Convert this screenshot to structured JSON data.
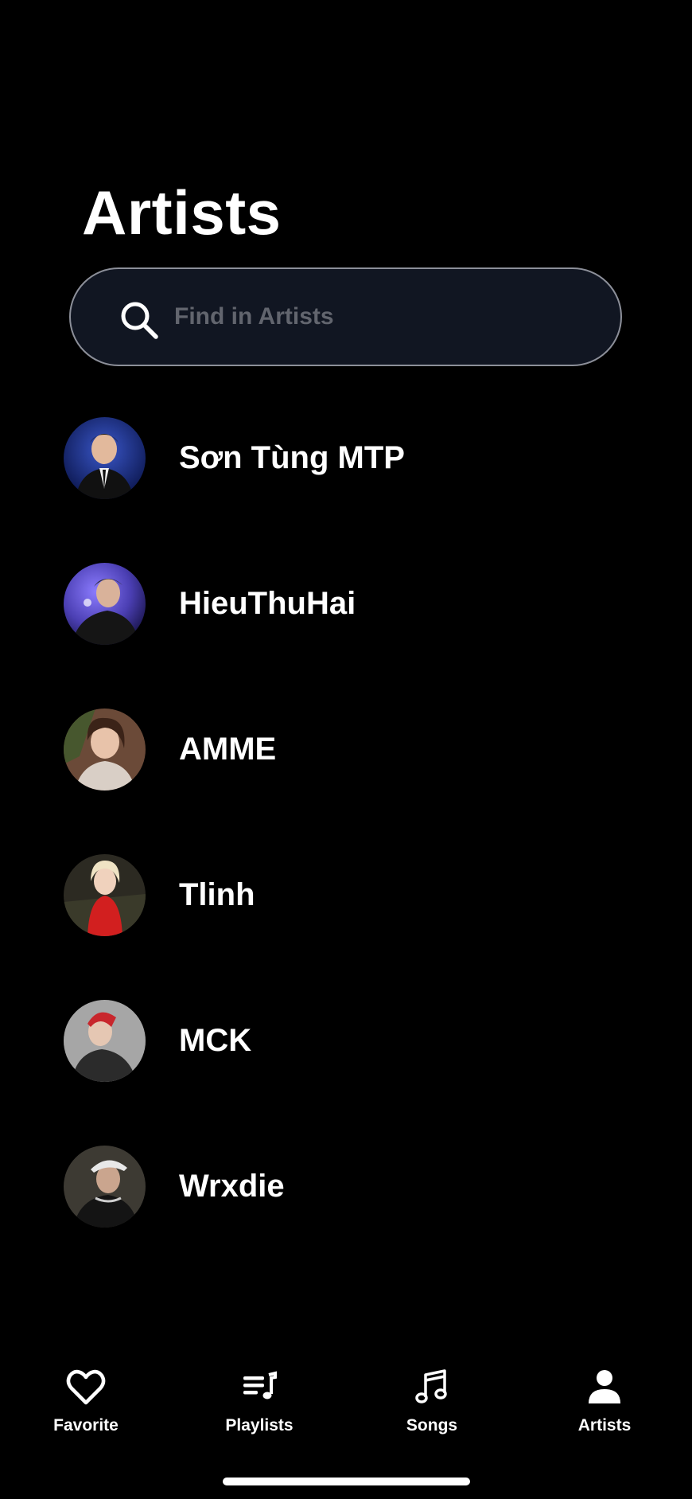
{
  "header": {
    "title": "Artists"
  },
  "search": {
    "placeholder": "Find in Artists",
    "value": ""
  },
  "artists": [
    {
      "name": "Sơn Tùng MTP"
    },
    {
      "name": "HieuThuHai"
    },
    {
      "name": "AMME"
    },
    {
      "name": "Tlinh"
    },
    {
      "name": "MCK"
    },
    {
      "name": "Wrxdie"
    }
  ],
  "tabs": [
    {
      "label": "Favorite",
      "icon": "heart-icon"
    },
    {
      "label": "Playlists",
      "icon": "playlist-icon"
    },
    {
      "label": "Songs",
      "icon": "music-note-icon"
    },
    {
      "label": "Artists",
      "icon": "person-icon",
      "active": true
    }
  ],
  "colors": {
    "background": "#000000",
    "search_bg": "#111622",
    "search_border": "#8c8f99",
    "placeholder": "#62656e",
    "text": "#ffffff"
  }
}
